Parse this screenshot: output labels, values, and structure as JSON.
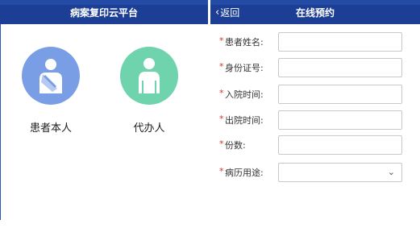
{
  "left_screen": {
    "title": "病案复印云平台",
    "options": [
      {
        "label": "患者本人",
        "icon": "patient-with-arm-sling-icon",
        "color": "#7a9ee6"
      },
      {
        "label": "代办人",
        "icon": "proxy-person-icon",
        "color": "#6fd3ad"
      }
    ]
  },
  "right_screen": {
    "back_label": "返回",
    "title": "在线预约",
    "required_mark": "*",
    "fields": [
      {
        "label": "患者姓名:",
        "value": "",
        "type": "text"
      },
      {
        "label": "身份证号:",
        "value": "",
        "type": "text"
      },
      {
        "label": "入院时间:",
        "value": "",
        "type": "text"
      },
      {
        "label": "出院时间:",
        "value": "",
        "type": "text"
      },
      {
        "label": "份数:",
        "value": "",
        "type": "text"
      },
      {
        "label": "病历用途:",
        "value": "",
        "type": "select"
      }
    ]
  },
  "colors": {
    "header": "#1c3f95",
    "required": "#d9342b"
  }
}
